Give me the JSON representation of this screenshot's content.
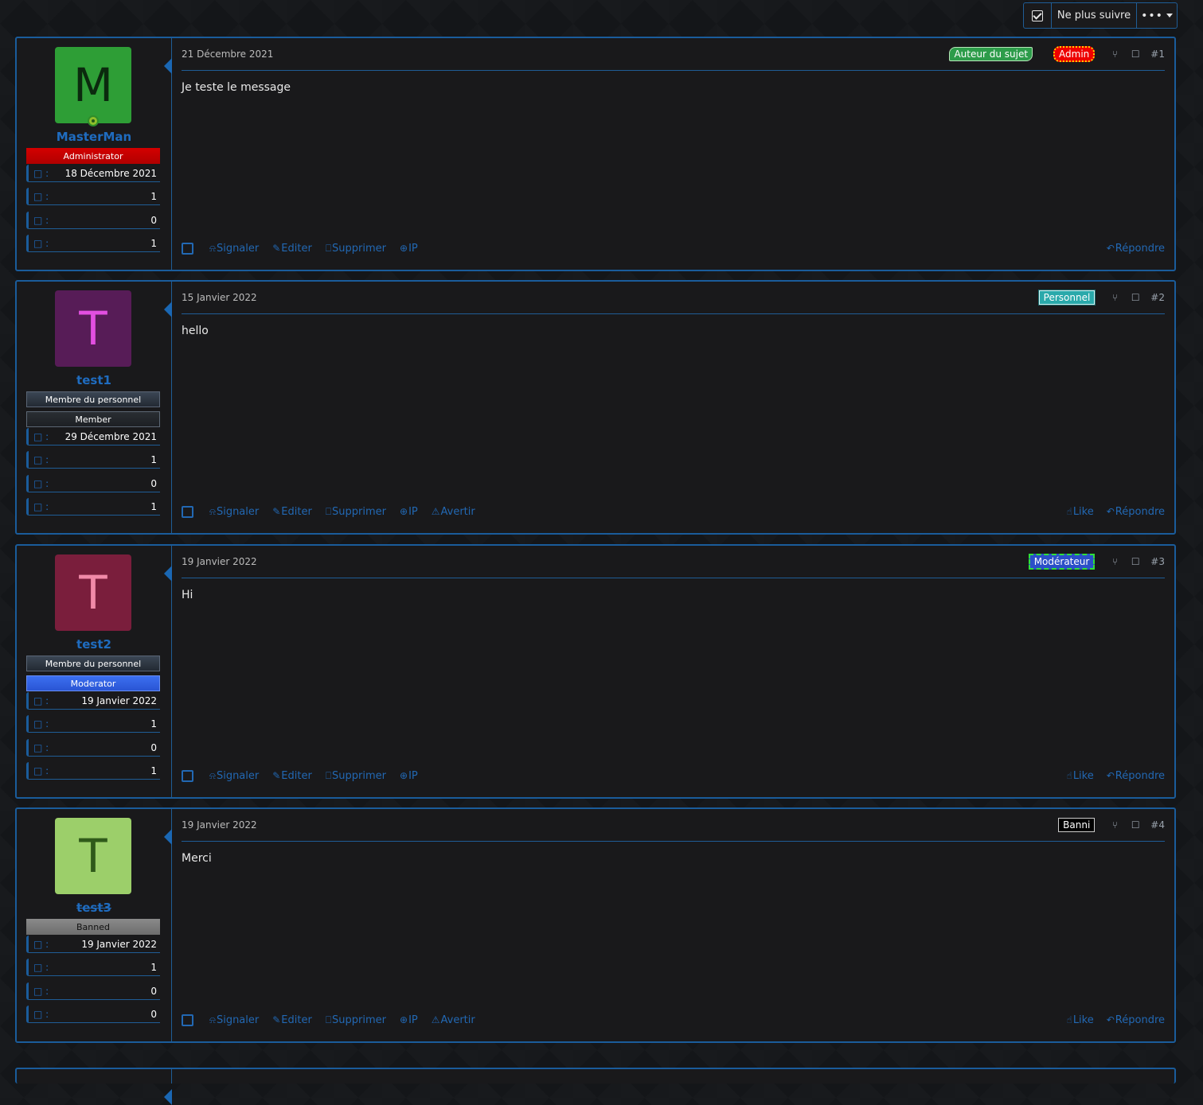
{
  "toolbar": {
    "unfollow_label": "Ne plus suivre",
    "more_label": "•••"
  },
  "icons": {
    "calendar": "calendar-icon",
    "messages": "messages-icon",
    "likes": "thumbs-up-icon",
    "trophy": "trophy-icon"
  },
  "posts": [
    {
      "username": "MasterMan",
      "initial": "M",
      "avatar_bg": "#2e9e36",
      "avatar_fg": "#0b2a0e",
      "titles": [
        {
          "label": "Administrator",
          "style": "admin"
        }
      ],
      "joined": "18 Décembre 2021",
      "messages": "1",
      "likes": "0",
      "points": "1",
      "date": "21 Décembre 2021",
      "badges": [
        {
          "label": "Auteur du sujet",
          "style": "author"
        },
        {
          "label": "Admin",
          "style": "adm"
        }
      ],
      "number": "#1",
      "body": "Je teste le message",
      "actions": [
        "Signaler",
        "Editer",
        "Supprimer",
        "IP"
      ],
      "right_actions": [
        "Répondre"
      ]
    },
    {
      "username": "test1",
      "initial": "T",
      "avatar_bg": "#571c57",
      "avatar_fg": "#e24fe0",
      "titles": [
        {
          "label": "Membre du personnel",
          "style": "staff"
        },
        {
          "label": "Member",
          "style": "member"
        }
      ],
      "joined": "29 Décembre 2021",
      "messages": "1",
      "likes": "0",
      "points": "1",
      "date": "15 Janvier 2022",
      "badges": [
        {
          "label": "Personnel",
          "style": "perso"
        }
      ],
      "number": "#2",
      "body": "hello",
      "actions": [
        "Signaler",
        "Editer",
        "Supprimer",
        "IP",
        "Avertir"
      ],
      "right_actions": [
        "Like",
        "Répondre"
      ]
    },
    {
      "username": "test2",
      "initial": "T",
      "avatar_bg": "#7a1e3c",
      "avatar_fg": "#f08aa8",
      "titles": [
        {
          "label": "Membre du personnel",
          "style": "staff"
        },
        {
          "label": "Moderator",
          "style": "mod"
        }
      ],
      "joined": "19 Janvier 2022",
      "messages": "1",
      "likes": "0",
      "points": "1",
      "date": "19 Janvier 2022",
      "badges": [
        {
          "label": "Modérateur",
          "style": "modo"
        }
      ],
      "number": "#3",
      "body": "Hi",
      "actions": [
        "Signaler",
        "Editer",
        "Supprimer",
        "IP"
      ],
      "right_actions": [
        "Like",
        "Répondre"
      ]
    },
    {
      "username": "test3",
      "initial": "T",
      "avatar_bg": "#9ccf6a",
      "avatar_fg": "#2f5a1a",
      "titles": [
        {
          "label": "Banned",
          "style": "banned"
        }
      ],
      "joined": "19 Janvier 2022",
      "messages": "1",
      "likes": "0",
      "points": "0",
      "date": "19 Janvier 2022",
      "badges": [
        {
          "label": "Banni",
          "style": "banni"
        }
      ],
      "number": "#4",
      "body": "Merci",
      "banned": true,
      "actions": [
        "Signaler",
        "Editer",
        "Supprimer",
        "IP",
        "Avertir"
      ],
      "right_actions": [
        "Like",
        "Répondre"
      ]
    }
  ]
}
